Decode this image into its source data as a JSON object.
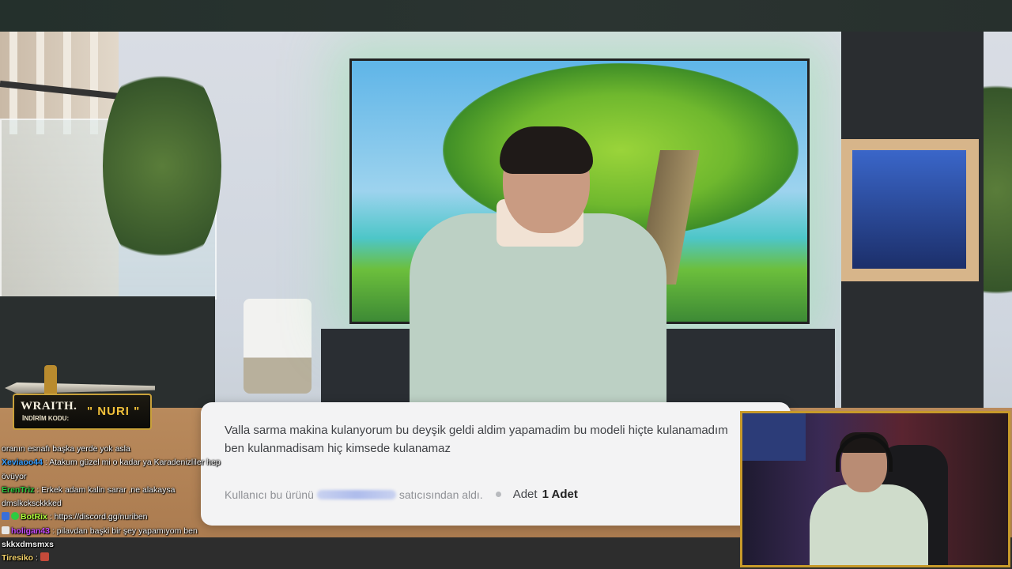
{
  "colors": {
    "frame_border": "#c79a2a",
    "review_bg": "#f3f3f4",
    "promo_code": "#f0c03a",
    "chat_user_1": "#3aa0ff",
    "chat_user_2": "#2ecc40",
    "chat_user_3": "#b0ff3a",
    "chat_user_4": "#c64cff",
    "chat_user_5": "#ffffff",
    "chat_user_6": "#f5d36b"
  },
  "promo": {
    "brand": "WRAITH.",
    "code_label": "İNDİRİM KODU:",
    "code": "\" NURI \""
  },
  "review": {
    "line1": "Valla sarma makina kulanyorum bu deyşik geldi aldim yapamadim bu modeli hiçte  kulanamadım",
    "line2": "ben kulanmadisam hiç kimsede kulanamaz",
    "purchase_prefix": "Kullanıcı bu ürünü",
    "purchase_suffix": "satıcısından aldı.",
    "qty_label": "Adet",
    "qty_value": "1 Adet"
  },
  "chat": [
    {
      "user": "",
      "user_color": "",
      "sep": "",
      "text": "oranın esnafı başka yerde yok asla",
      "badges": []
    },
    {
      "user": "Xeviaoo44",
      "user_color": "#3aa0ff",
      "sep": " : ",
      "text": "Atakum güzel mi o kadar ya Karadenizliler hep övüyor",
      "badges": []
    },
    {
      "user": "ErenTriz",
      "user_color": "#2ecc40",
      "sep": " : ",
      "text": "Erkek adam kalin sarar ,ne alakaysa dmslkcksckkked",
      "badges": []
    },
    {
      "user": "BotRix",
      "user_color": "#b0ff3a",
      "sep": " : ",
      "text": "https://discord.gg/nuriben",
      "badges": [
        "mod-badge-icon",
        "verified-badge-icon"
      ]
    },
    {
      "user": "holigan43",
      "user_color": "#c64cff",
      "sep": " : ",
      "text": "pilavdan başki bir şey yapamıyom ben",
      "badges": [
        "chess-badge-icon"
      ]
    },
    {
      "user": "",
      "user_color": "",
      "sep": "",
      "text": "skkxdmsmxs",
      "badges": []
    },
    {
      "user": "Tiresiko",
      "user_color": "#f5d36b",
      "sep": " : ",
      "text": "",
      "badges": [],
      "emote": "emote-icon"
    }
  ]
}
